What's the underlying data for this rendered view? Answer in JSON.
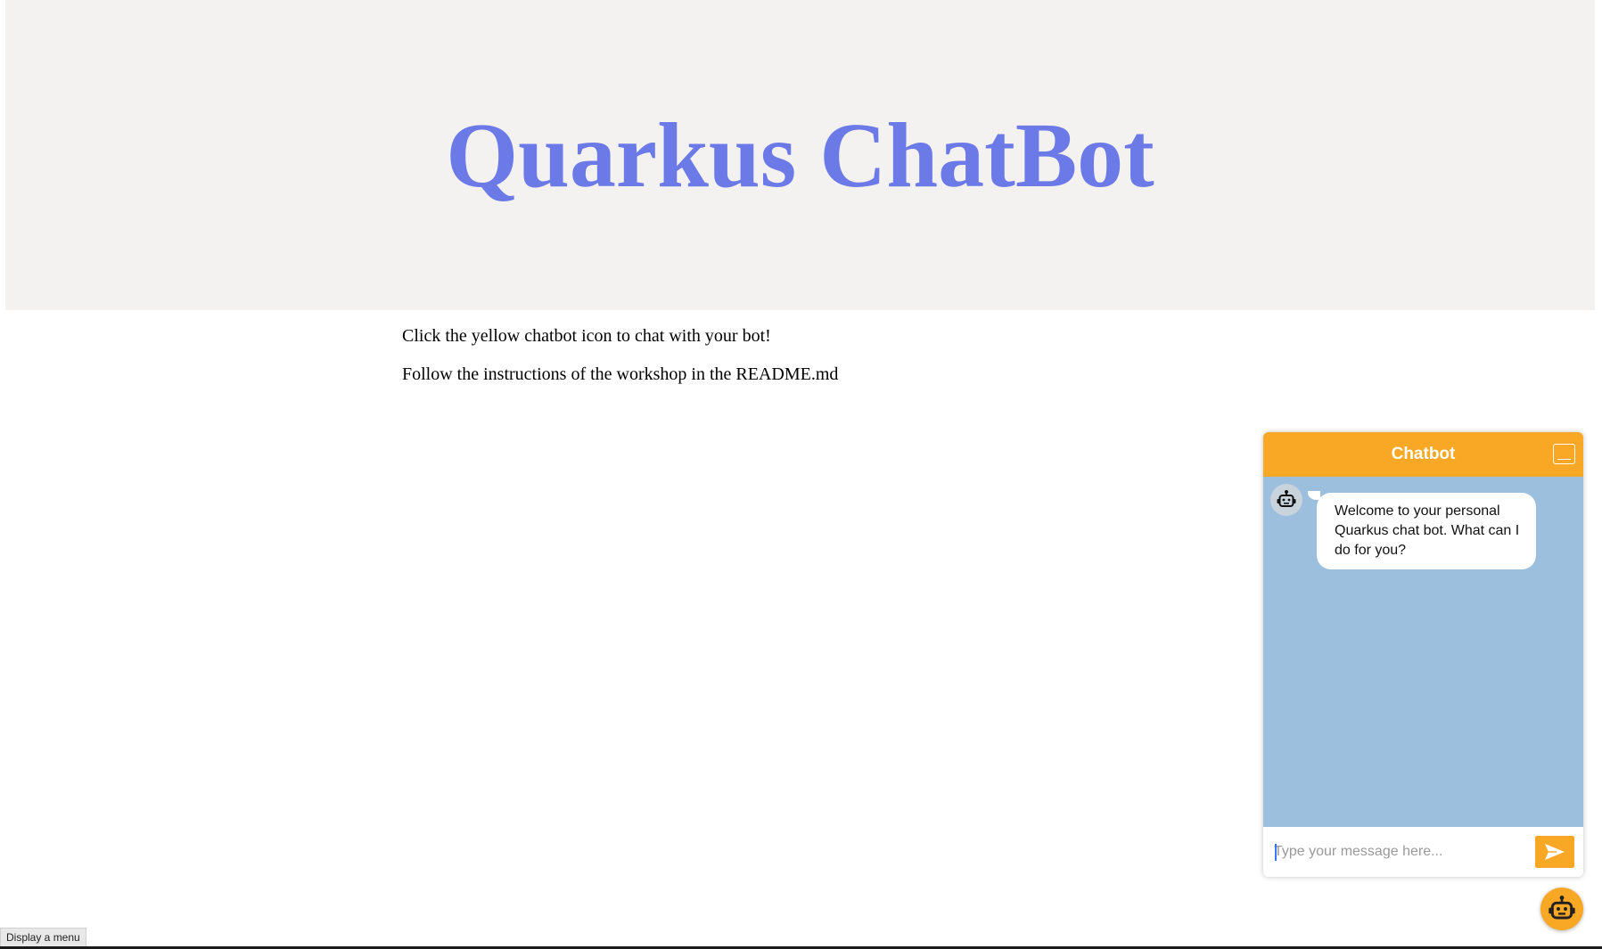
{
  "header": {
    "title": "Quarkus ChatBot"
  },
  "content": {
    "line1": "Click the yellow chatbot icon to chat with your bot!",
    "line2": "Follow the instructions of the workshop in the README.md"
  },
  "chat": {
    "header_title": "Chatbot",
    "messages": [
      {
        "sender": "bot",
        "text": "Welcome to your personal Quarkus chat bot. What can I do for you?"
      }
    ],
    "input": {
      "placeholder": "Type your message here...",
      "value": ""
    },
    "icons": {
      "minimize": "minimize-icon",
      "avatar": "robot-icon",
      "send": "send-icon",
      "launcher": "robot-icon"
    }
  },
  "status": {
    "tooltip": "Display a menu"
  },
  "colors": {
    "accent": "#f9a825",
    "title": "#6c7ae8",
    "chat_body": "#9dbfde",
    "header_band": "#f4f1f1"
  }
}
